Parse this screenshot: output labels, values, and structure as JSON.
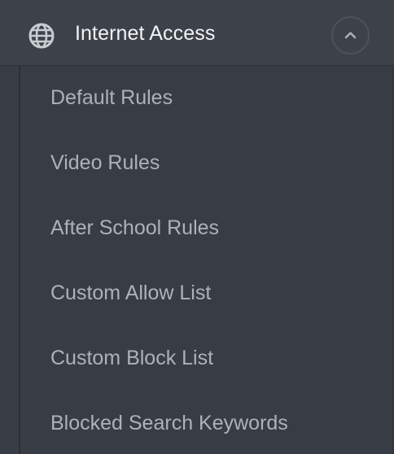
{
  "menu": {
    "title": "Internet Access",
    "icon": "globe-icon",
    "toggle_icon": "chevron-up-icon",
    "expanded": true,
    "items": [
      {
        "label": "Default Rules"
      },
      {
        "label": "Video Rules"
      },
      {
        "label": "After School Rules"
      },
      {
        "label": "Custom Allow List"
      },
      {
        "label": "Custom Block List"
      },
      {
        "label": "Blocked Search Keywords"
      }
    ]
  },
  "colors": {
    "header_background": "#3d424a",
    "submenu_background": "#383d45",
    "header_text": "#f2f3f5",
    "item_text": "#aeb1b6",
    "toggle_border": "#4d525a"
  }
}
